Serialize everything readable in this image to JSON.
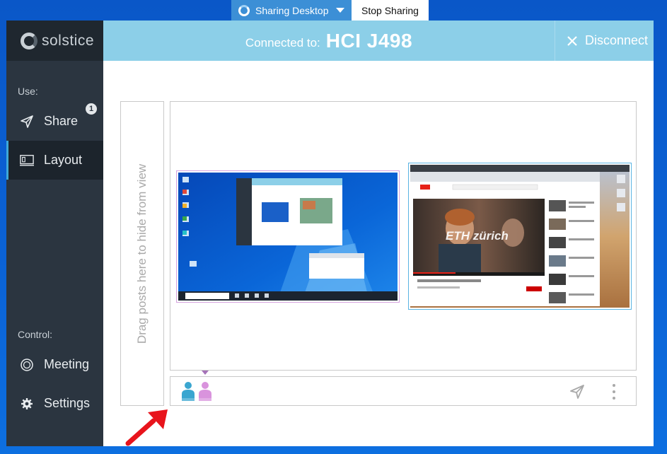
{
  "share_bar": {
    "sharing_label": "Sharing Desktop",
    "stop_label": "Stop Sharing"
  },
  "app": {
    "logo_text": "solstice"
  },
  "sidebar": {
    "use_label": "Use:",
    "control_label": "Control:",
    "items": [
      {
        "label": "Share",
        "icon": "send-icon",
        "badge": "1"
      },
      {
        "label": "Layout",
        "icon": "layout-icon",
        "active": true
      },
      {
        "label": "Meeting",
        "icon": "meeting-icon"
      },
      {
        "label": "Settings",
        "icon": "gear-icon"
      }
    ]
  },
  "header": {
    "connected_label": "Connected to:",
    "room_name": "HCI J498",
    "disconnect_label": "Disconnect"
  },
  "layout": {
    "hide_zone_text": "Drag posts here to hide from view",
    "posts": [
      {
        "content": "windows-desktop-screenshot",
        "border_color": "#d6a3df"
      },
      {
        "content": "youtube-eth-zurich-video",
        "logo_text": "ETH zürich",
        "border_color": "#5ab4e3"
      }
    ]
  },
  "colors": {
    "sidebar": "#2b3540",
    "header": "#8ccfe8",
    "accent": "#3fa8d8",
    "desktop": "#0b63d6"
  }
}
